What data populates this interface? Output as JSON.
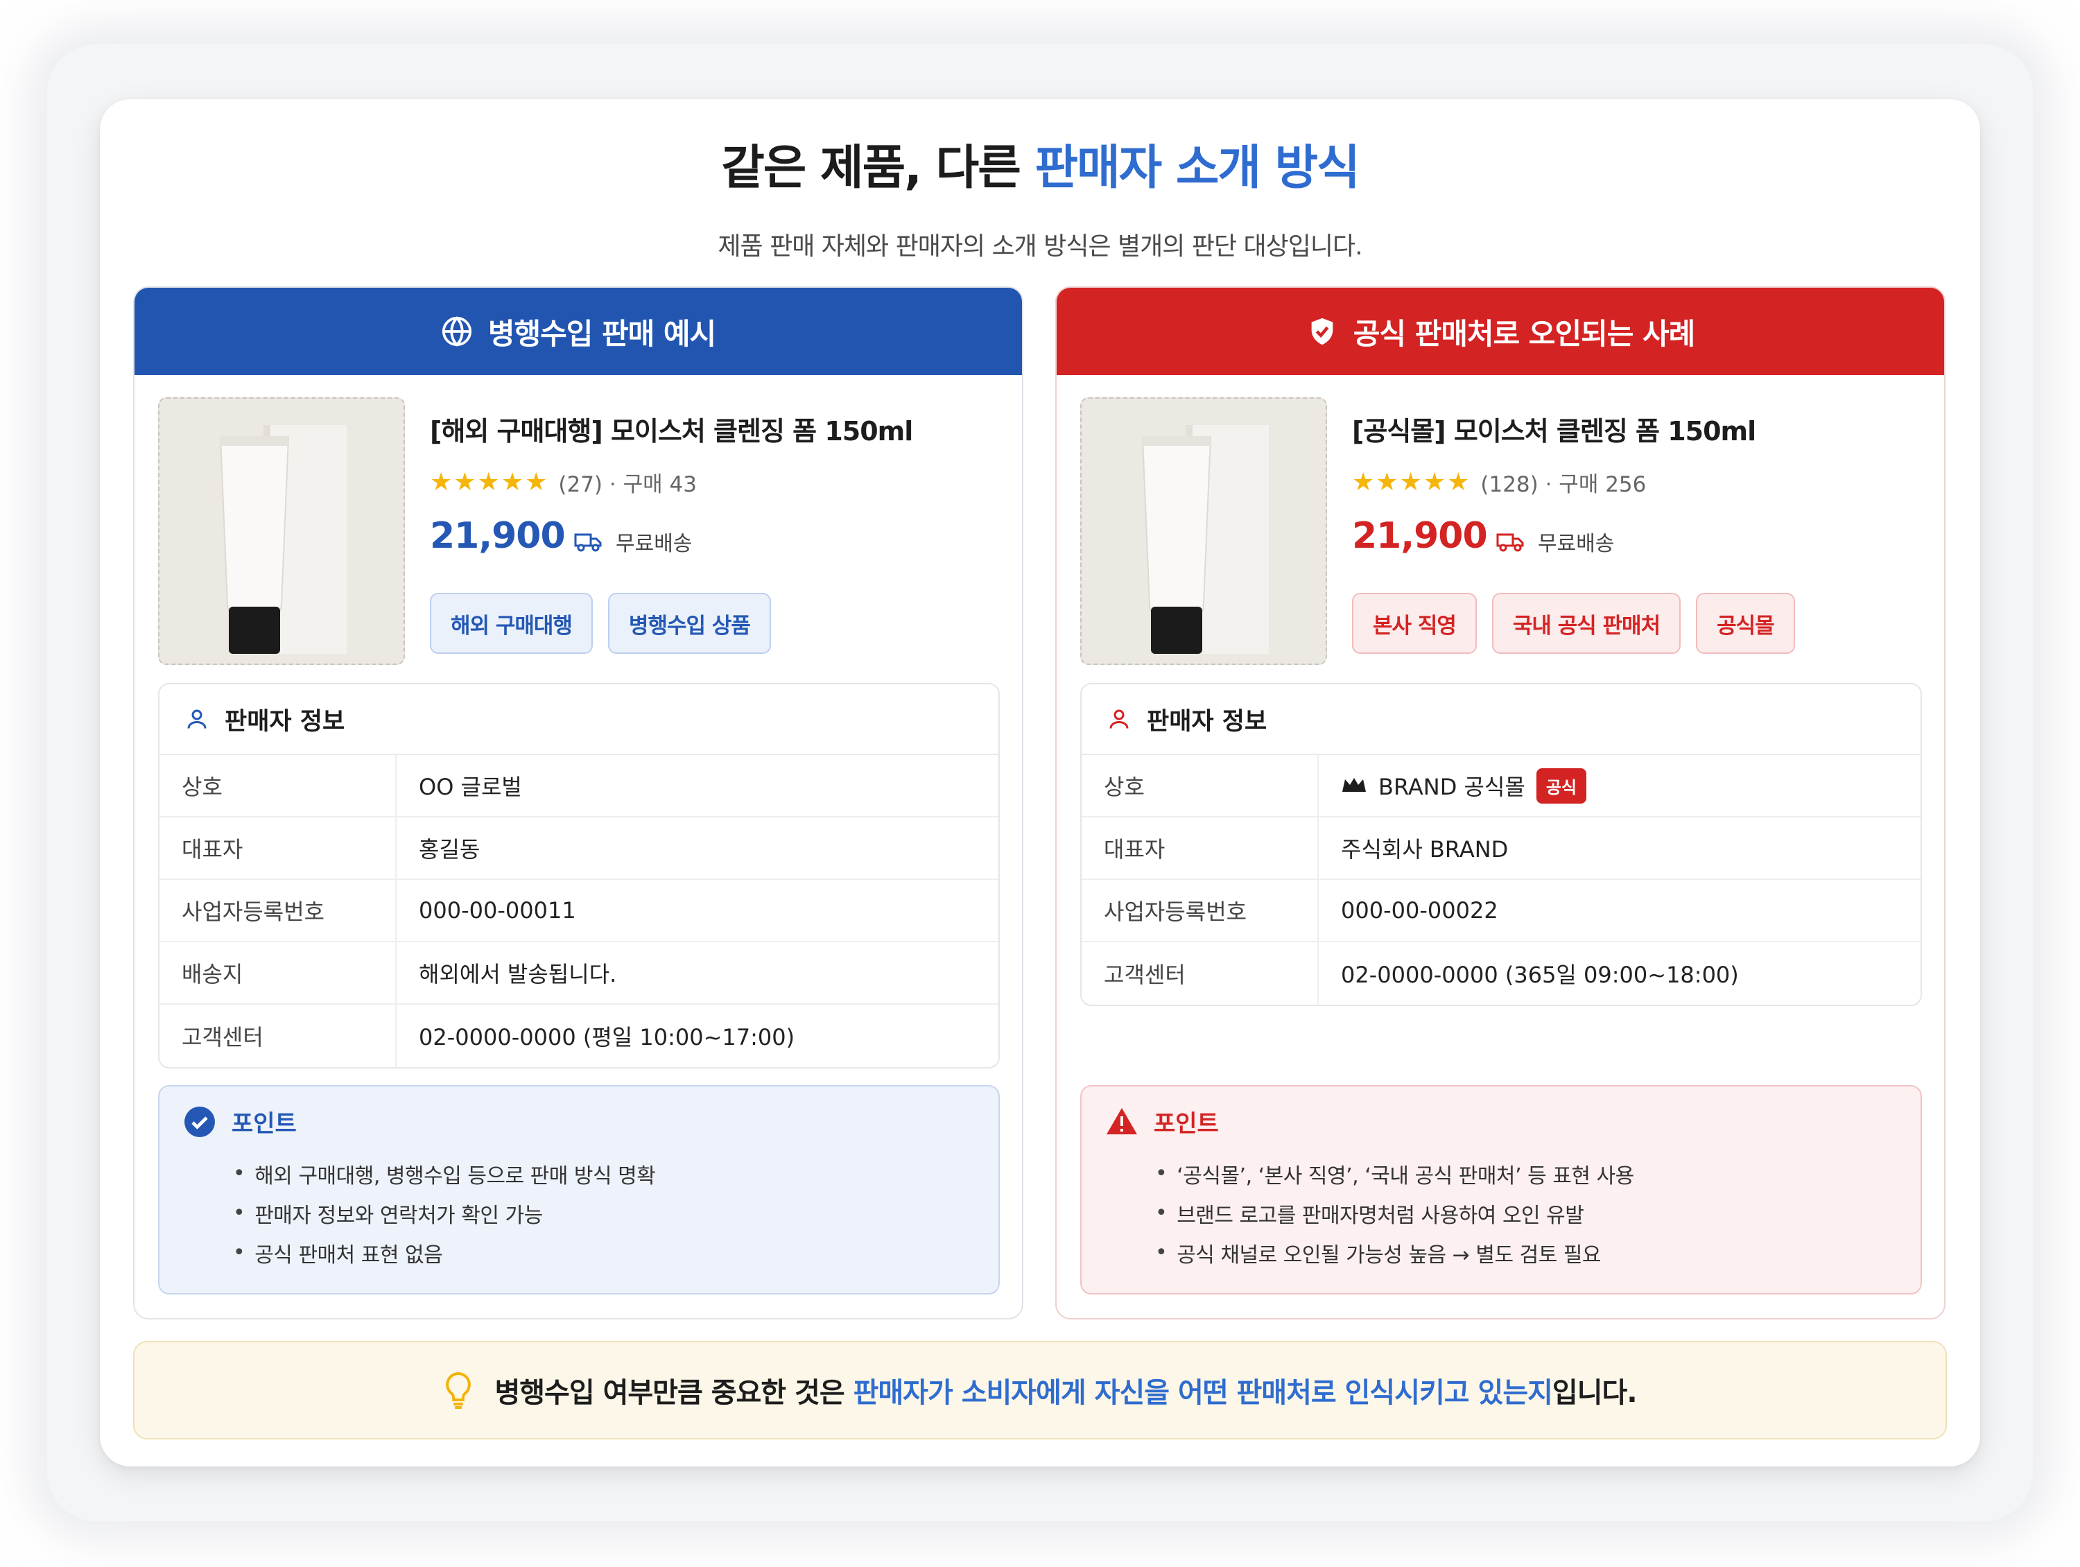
{
  "title": {
    "prefix": "같은 제품, 다른 ",
    "accent": "판매자 소개 방식"
  },
  "subtitle": "제품 판매 자체와 판매자의 소개 방식은 별개의 판단 대상입니다.",
  "left": {
    "header": "병행수입 판매 예시",
    "header_icon": "globe-icon",
    "product_name": "[해외 구매대행] 모이스처 클렌징 폼 150ml",
    "stars": "★★★★★",
    "reviews": "(27) · 구매 43",
    "price": "21,900",
    "shipping": "무료배송",
    "tags": [
      "해외 구매대행",
      "병행수입 상품"
    ],
    "seller_title": "판매자 정보",
    "seller_rows": [
      {
        "k": "상호",
        "v": "OO 글로벌"
      },
      {
        "k": "대표자",
        "v": "홍길동"
      },
      {
        "k": "사업자등록번호",
        "v": "000-00-00011"
      },
      {
        "k": "배송지",
        "v": "해외에서 발송됩니다."
      },
      {
        "k": "고객센터",
        "v": "02-0000-0000 (평일 10:00~17:00)"
      }
    ],
    "point_title": "포인트",
    "points": [
      "해외 구매대행, 병행수입 등으로 판매 방식 명확",
      "판매자 정보와 연락처가 확인 가능",
      "공식 판매처 표현 없음"
    ],
    "accent_color": "#2155b0"
  },
  "right": {
    "header": "공식 판매처로 오인되는 사례",
    "header_icon": "shield-check-icon",
    "product_name": "[공식몰] 모이스처 클렌징 폼 150ml",
    "stars": "★★★★★",
    "reviews": "(128) · 구매 256",
    "price": "21,900",
    "shipping": "무료배송",
    "tags": [
      "본사 직영",
      "국내 공식 판매처",
      "공식몰"
    ],
    "seller_title": "판매자 정보",
    "seller_rows": [
      {
        "k": "상호",
        "v": "BRAND 공식몰",
        "badge": "공식"
      },
      {
        "k": "대표자",
        "v": "주식회사 BRAND"
      },
      {
        "k": "사업자등록번호",
        "v": "000-00-00022"
      },
      {
        "k": "고객센터",
        "v": "02-0000-0000 (365일 09:00~18:00)"
      }
    ],
    "point_title": "포인트",
    "points": [
      "‘공식몰’, ‘본사 직영’, ‘국내 공식 판매처’ 등 표현 사용",
      "브랜드 로고를 판매자명처럼 사용하여 오인 유발",
      "공식 채널로 오인될 가능성 높음 → 별도 검토 필요"
    ],
    "accent_color": "#d42323"
  },
  "bottom": {
    "prefix": "병행수입 여부만큼 중요한 것은 ",
    "accent": "판매자가 소비자에게 자신을 어떤 판매처로 인식시키고 있는지",
    "suffix": "입니다.",
    "icon": "lightbulb-icon"
  }
}
